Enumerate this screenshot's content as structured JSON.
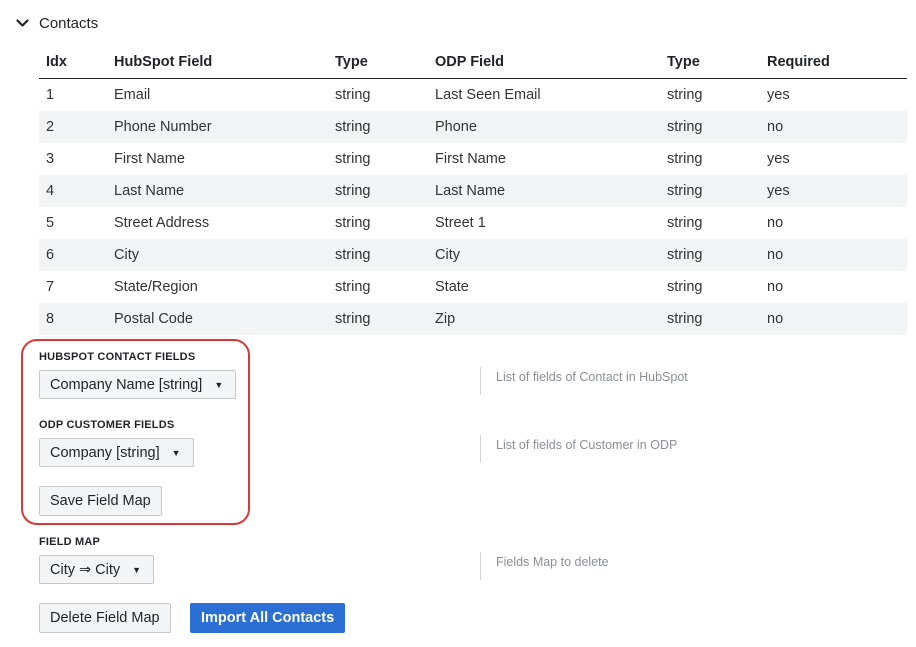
{
  "section": {
    "title": "Contacts"
  },
  "table": {
    "headers": [
      "Idx",
      "HubSpot Field",
      "Type",
      "ODP Field",
      "Type",
      "Required"
    ],
    "rows": [
      [
        "1",
        "Email",
        "string",
        "Last Seen Email",
        "string",
        "yes"
      ],
      [
        "2",
        "Phone Number",
        "string",
        "Phone",
        "string",
        "no"
      ],
      [
        "3",
        "First Name",
        "string",
        "First Name",
        "string",
        "yes"
      ],
      [
        "4",
        "Last Name",
        "string",
        "Last Name",
        "string",
        "yes"
      ],
      [
        "5",
        "Street Address",
        "string",
        "Street 1",
        "string",
        "no"
      ],
      [
        "6",
        "City",
        "string",
        "City",
        "string",
        "no"
      ],
      [
        "7",
        "State/Region",
        "string",
        "State",
        "string",
        "no"
      ],
      [
        "8",
        "Postal Code",
        "string",
        "Zip",
        "string",
        "no"
      ]
    ]
  },
  "hubspot_fields": {
    "label": "HUBSPOT CONTACT FIELDS",
    "selected": "Company Name [string]",
    "help": "List of fields of Contact in HubSpot"
  },
  "odp_fields": {
    "label": "ODP CUSTOMER FIELDS",
    "selected": "Company [string]",
    "help": "List of fields of Customer in ODP"
  },
  "save_button": {
    "label": "Save Field Map"
  },
  "field_map": {
    "label": "FIELD MAP",
    "selected": "City ⇒ City",
    "help": "Fields Map to delete"
  },
  "actions": {
    "delete_label": "Delete Field Map",
    "import_label": "Import All Contacts"
  },
  "colors": {
    "primary": "#2b6fd4",
    "highlight": "#d9383a",
    "row_stripe": "#f2f4f6"
  },
  "icons": {
    "collapse": "chevron-down-icon",
    "dropdown": "caret-down-icon"
  }
}
